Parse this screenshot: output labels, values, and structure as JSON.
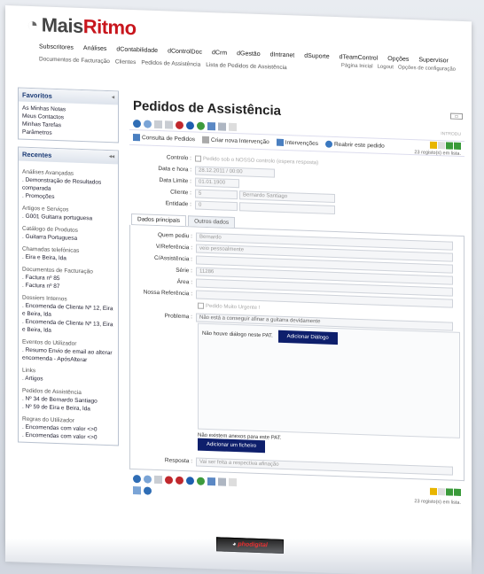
{
  "brand": {
    "left": "Mais",
    "right": "Ritmo"
  },
  "topnav": [
    "Subscritores",
    "Análises",
    "dContabilidade",
    "dControlDoc",
    "dCrm",
    "dGestão",
    "dIntranet",
    "dSuporte",
    "dTeamControl",
    "Opções",
    "Supervisor"
  ],
  "subnav": [
    "Documentos de Facturação",
    "Clientes",
    "Pedidos de Assistência",
    "Lista de Pedidos de Assistência"
  ],
  "toplinks": [
    "Página Inicial",
    "Logout",
    "Opções de configuração"
  ],
  "favoritos": {
    "title": "Favoritos",
    "items": [
      "As Minhas Notas",
      "Meus Contactos",
      "Minhas Tarefas",
      "Parâmetros"
    ]
  },
  "recentes": {
    "title": "Recentes",
    "groups": [
      {
        "title": "Análises Avançadas",
        "items": [
          ". Demonstração de Resultados comparada",
          ". Promoções"
        ]
      },
      {
        "title": "Artigos e Serviços",
        "items": [
          ". G001 Guitarra portuguesa"
        ]
      },
      {
        "title": "Catálogo de Produtos",
        "items": [
          ". Guitarra Portuguesa"
        ]
      },
      {
        "title": "Chamadas telefónicas",
        "items": [
          ". Eira e Beira, lda"
        ]
      },
      {
        "title": "Documentos de Facturação",
        "items": [
          ". Factura nº 85",
          ". Factura nº 87"
        ]
      },
      {
        "title": "Dossiers Internos",
        "items": [
          ". Encomenda de Cliente Nº 12, Eira e Beira, lda",
          ". Encomenda de Cliente Nº 13, Eira e Beira, lda"
        ]
      },
      {
        "title": "Eventos do Utilizador",
        "items": [
          ". Resumo Envio de email ao alterar encomenda - ApósAlterar"
        ]
      },
      {
        "title": "Links",
        "items": [
          ". Artigos"
        ]
      },
      {
        "title": "Pedidos de Assistência",
        "items": [
          ". Nº 34 de Bernardo Santiago",
          ". Nº 59 de Eira e Beira, lda"
        ]
      },
      {
        "title": "Regras do Utilizador",
        "items": [
          ". Encomendas com valor <>0",
          ". Encomendas com valor <>0"
        ]
      }
    ]
  },
  "page": {
    "title": "Pedidos de Assistência",
    "introducao": "INTRODU",
    "count": "23 registo(s) em lista."
  },
  "actions": [
    "Consulta de Pedidos",
    "Criar nova Intervenção",
    "Intervenções",
    "Reabrir este pedido"
  ],
  "header_fields": {
    "controlo": {
      "label": "Controlo :",
      "value": "Pedido sob o NOSSO controlo (espera resposta)"
    },
    "data_hora": {
      "label": "Data e hora :",
      "value": "28.12.2011 / 00:00"
    },
    "data_limite": {
      "label": "Data Limite :",
      "value": "01.01.1900"
    },
    "cliente": {
      "label": "Cliente :",
      "value": "5",
      "name": "Bernardo Santiago"
    },
    "entidade": {
      "label": "Entidade :",
      "value": "0"
    }
  },
  "tabs": [
    "Dados principais",
    "Outros dados"
  ],
  "main_fields": {
    "quem_pediu": {
      "label": "Quem pediu :",
      "value": "Bernardo"
    },
    "v_referencia": {
      "label": "V/Referência :",
      "value": "veio pessoalmente"
    },
    "c_assistencia": {
      "label": "C/Assistência :",
      "value": ""
    },
    "serie": {
      "label": "Série :",
      "value": "11286"
    },
    "area": {
      "label": "Área :",
      "value": ""
    },
    "nossa_ref": {
      "label": "Nossa Referência :",
      "value": ""
    },
    "urgente": "Pedido Muito Urgente !",
    "problema": {
      "label": "Problema :",
      "value": "Não está a conseguir afinar a guitarra devidamente"
    },
    "no_dialog": "Não houve diálogo neste PAT.",
    "add_dialog": "Adicionar Diálogo",
    "no_attach": "Não existem anexos para este PAT.",
    "add_file": "Adicionar um ficheiro",
    "resposta": {
      "label": "Resposta :",
      "value": "Vai ser feita a respectiva afinação"
    }
  },
  "footer": {
    "left": "pho",
    "right": "digital"
  },
  "colors": {
    "accent": "#c8161d",
    "nav": "#1a3a75",
    "button": "#0e1f6c"
  }
}
